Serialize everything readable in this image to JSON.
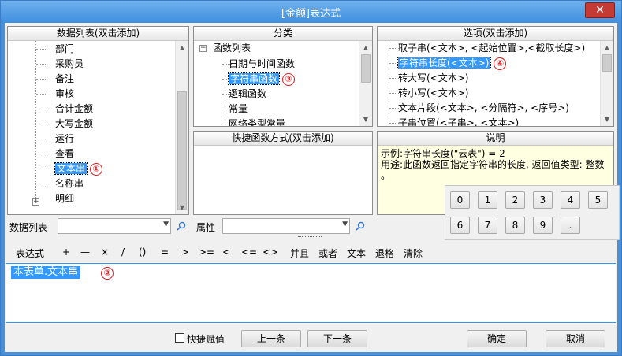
{
  "window": {
    "title": "[金额]表达式",
    "close_label": "✕"
  },
  "data_list": {
    "header": "数据列表(双击添加)",
    "items": [
      "部门",
      "采购员",
      "备注",
      "审核",
      "合计金额",
      "大写金额",
      "运行",
      "查看",
      "文本串",
      "名称串",
      "明细"
    ],
    "selected_index": 8,
    "selected_badge": "①"
  },
  "category": {
    "header": "分类",
    "root": "函数列表",
    "items": [
      "日期与时间函数",
      "字符串函数",
      "逻辑函数",
      "常量",
      "网络类型常量"
    ],
    "selected_index": 1,
    "selected_badge": "③"
  },
  "options": {
    "header": "选项(双击添加)",
    "items": [
      "取子串(<文本>, <起始位置>,<截取长度>)",
      "字符串长度(<文本>)",
      "转大写(<文本>)",
      "转小写(<文本>)",
      "文本片段(<文本>, <分隔符>, <序号>)",
      "子串位置(<子串>, <文本>)"
    ],
    "selected_index": 1,
    "selected_badge": "④"
  },
  "shortcut": {
    "header": "快捷函数方式(双击添加)"
  },
  "description": {
    "header": "说明",
    "line1": "示例:字符串长度(\"云表\") = 2",
    "line2": "用途:此函数返回指定字符串的长度, 返回值类型: 整数",
    "line3": "。"
  },
  "filters": {
    "data_list_label": "数据列表",
    "attr_label": "属性"
  },
  "toolbar": {
    "expr_label": "表达式",
    "ops": [
      "+",
      "—",
      "×",
      "/",
      "()",
      "=",
      ">",
      ">=",
      "<",
      "<=",
      "<>",
      "并且",
      "或者",
      "文本",
      "退格",
      "清除"
    ]
  },
  "expression": {
    "value": "本表单.文本串",
    "badge": "②"
  },
  "keypad": {
    "keys": [
      "0",
      "1",
      "2",
      "3",
      "4",
      "5",
      "6",
      "7",
      "8",
      "9",
      "."
    ]
  },
  "footer": {
    "quick_assign": "快捷赋值",
    "prev": "上一条",
    "next": "下一条",
    "ok": "确定",
    "cancel": "取消"
  },
  "colors": {
    "selection": "#3399ff",
    "badge": "#e0191d",
    "title_bar": "#3f8fe0"
  }
}
